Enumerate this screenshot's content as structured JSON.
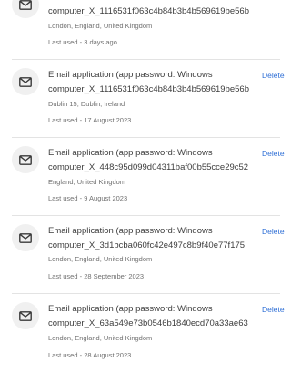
{
  "entries": [
    {
      "title": "",
      "device": "computer_X_1116531f063c4b84b3b4b569619be56b",
      "location": "London, England, United Kingdom",
      "last_used": "Last used - 3 days ago",
      "delete_label": "",
      "icon": "mail-icon"
    },
    {
      "title": "Email application (app password: Windows",
      "device": "computer_X_1116531f063c4b84b3b4b569619be56b",
      "location": "Dublin 15, Dublin, Ireland",
      "last_used": "Last used - 17 August 2023",
      "delete_label": "Delete",
      "icon": "mail-icon"
    },
    {
      "title": "Email application (app password: Windows",
      "device": "computer_X_448c95d099d04311baf00b55cce29c52",
      "location": "England, United Kingdom",
      "last_used": "Last used - 9 August 2023",
      "delete_label": "Delete",
      "icon": "mail-icon"
    },
    {
      "title": "Email application (app password: Windows",
      "device": "computer_X_3d1bcba060fc42e497c8b9f40e77f175",
      "location": "London, England, United Kingdom",
      "last_used": "Last used - 28 September 2023",
      "delete_label": "Delete",
      "icon": "mail-icon"
    },
    {
      "title": "Email application (app password: Windows",
      "device": "computer_X_63a549e73b0546b1840ecd70a33ae63",
      "location": "London, England, United Kingdom",
      "last_used": "Last used - 28 August 2023",
      "delete_label": "Delete",
      "icon": "mail-icon"
    }
  ]
}
